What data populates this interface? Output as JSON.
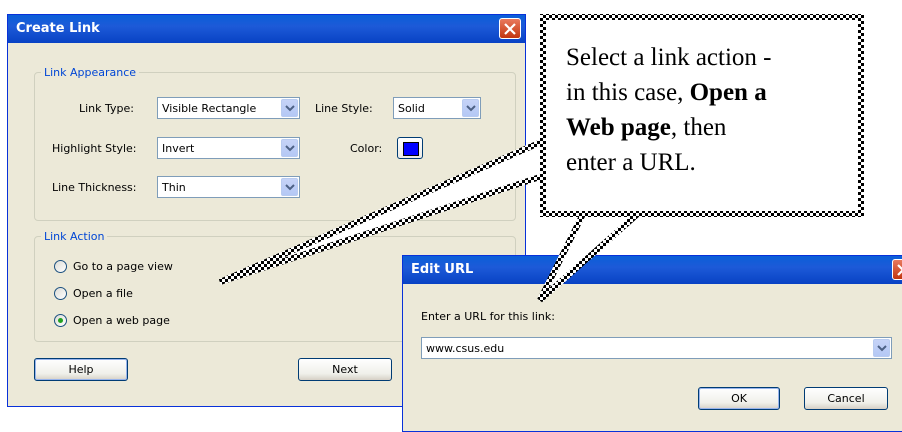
{
  "create_link": {
    "title": "Create Link",
    "appearance_legend": "Link Appearance",
    "link_type_label": "Link Type:",
    "link_type_value": "Visible Rectangle",
    "line_style_label": "Line Style:",
    "line_style_value": "Solid",
    "highlight_label": "Highlight Style:",
    "highlight_value": "Invert",
    "color_label": "Color:",
    "color_value": "#0000ff",
    "thickness_label": "Line Thickness:",
    "thickness_value": "Thin",
    "action_legend": "Link Action",
    "actions": [
      {
        "label": "Go to a page view",
        "selected": false
      },
      {
        "label": "Open a file",
        "selected": false
      },
      {
        "label": "Open a web page",
        "selected": true
      }
    ],
    "help_label": "Help",
    "next_label": "Next"
  },
  "edit_url": {
    "title": "Edit URL",
    "prompt": "Enter a URL for this link:",
    "url_value": "www.csus.edu",
    "ok_label": "OK",
    "cancel_label": "Cancel"
  },
  "callout": {
    "line1": "Select a link action -",
    "line2_pre": "in this case, ",
    "line2_bold": "Open a",
    "line3_bold": "Web page",
    "line3_post": ", then",
    "line4": "enter a URL."
  },
  "colors": {
    "title_bar": "#0a5fd8",
    "dialog_bg": "#ece9d8",
    "group_legend": "#0046d5",
    "selected_radio": "#21a121"
  }
}
